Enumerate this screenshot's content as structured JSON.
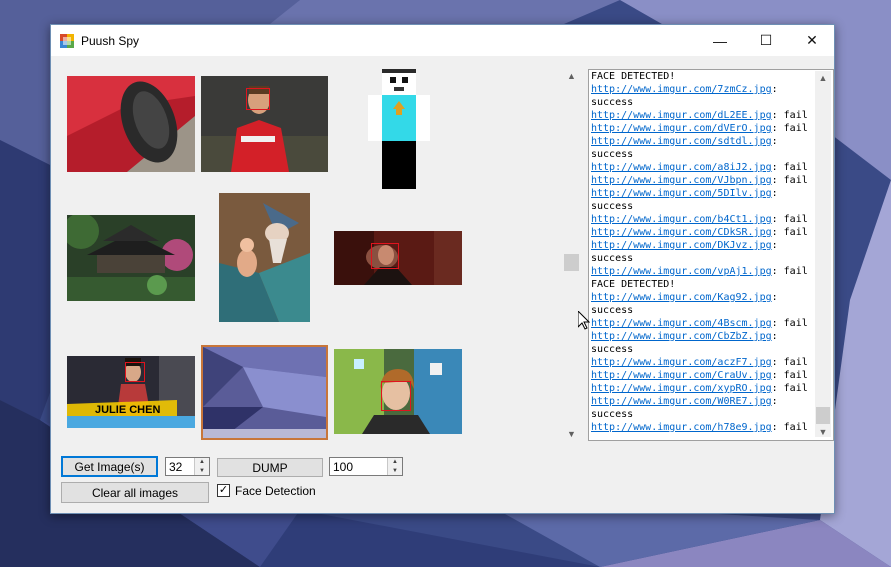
{
  "window": {
    "title": "Puush Spy",
    "minimize": "—",
    "maximize": "☐",
    "close": "✕"
  },
  "controls": {
    "get_images_label": "Get Image(s)",
    "count_value": "32",
    "dump_label": "DUMP",
    "limit_value": "100",
    "clear_label": "Clear all images",
    "face_detection_label": "Face Detection",
    "face_detection_checked": true
  },
  "log": [
    {
      "text": "FACE DETECTED!"
    },
    {
      "link": "http://www.imgur.com/7zmCz.jpg",
      "suffix": ":"
    },
    {
      "text": "success"
    },
    {
      "link": "http://www.imgur.com/dL2EE.jpg",
      "suffix": ": fail"
    },
    {
      "link": "http://www.imgur.com/dVErO.jpg",
      "suffix": ": fail"
    },
    {
      "link": "http://www.imgur.com/sdtdl.jpg",
      "suffix": ":"
    },
    {
      "text": "success"
    },
    {
      "link": "http://www.imgur.com/a8iJ2.jpg",
      "suffix": ": fail"
    },
    {
      "link": "http://www.imgur.com/VJbpn.jpg",
      "suffix": ": fail"
    },
    {
      "link": "http://www.imgur.com/5DIlv.jpg",
      "suffix": ":"
    },
    {
      "text": "success"
    },
    {
      "link": "http://www.imgur.com/b4Ct1.jpg",
      "suffix": ": fail"
    },
    {
      "link": "http://www.imgur.com/CDkSR.jpg",
      "suffix": ": fail"
    },
    {
      "link": "http://www.imgur.com/DKJvz.jpg",
      "suffix": ":"
    },
    {
      "text": "success"
    },
    {
      "link": "http://www.imgur.com/vpAj1.jpg",
      "suffix": ": fail"
    },
    {
      "text": "FACE DETECTED!"
    },
    {
      "link": "http://www.imgur.com/Kag92.jpg",
      "suffix": ":"
    },
    {
      "text": "success"
    },
    {
      "link": "http://www.imgur.com/4Bscm.jpg",
      "suffix": ": fail"
    },
    {
      "link": "http://www.imgur.com/CbZbZ.jpg",
      "suffix": ":"
    },
    {
      "text": "success"
    },
    {
      "link": "http://www.imgur.com/aczF7.jpg",
      "suffix": ": fail"
    },
    {
      "link": "http://www.imgur.com/CraUv.jpg",
      "suffix": ": fail"
    },
    {
      "link": "http://www.imgur.com/xypRO.jpg",
      "suffix": ": fail"
    },
    {
      "link": "http://www.imgur.com/W0RE7.jpg",
      "suffix": ":"
    },
    {
      "text": "success"
    },
    {
      "link": "http://www.imgur.com/h78e9.jpg",
      "suffix": ": fail"
    }
  ],
  "thumbnails": [
    {
      "subject": "car-tire"
    },
    {
      "subject": "footballer",
      "face": true
    },
    {
      "subject": "pixel-character"
    },
    {
      "subject": "pagoda-garden"
    },
    {
      "subject": "cartoon-wizard"
    },
    {
      "subject": "man-in-dim-room",
      "face": true
    },
    {
      "subject": "tv-host",
      "face": true,
      "caption": "JULIE CHEN"
    },
    {
      "subject": "desktop-wallpaper",
      "selected": true
    },
    {
      "subject": "young-man",
      "face": true
    }
  ],
  "colors": {
    "accent": "#0078d7",
    "link": "#0066cc",
    "face_box": "#e0141e"
  }
}
